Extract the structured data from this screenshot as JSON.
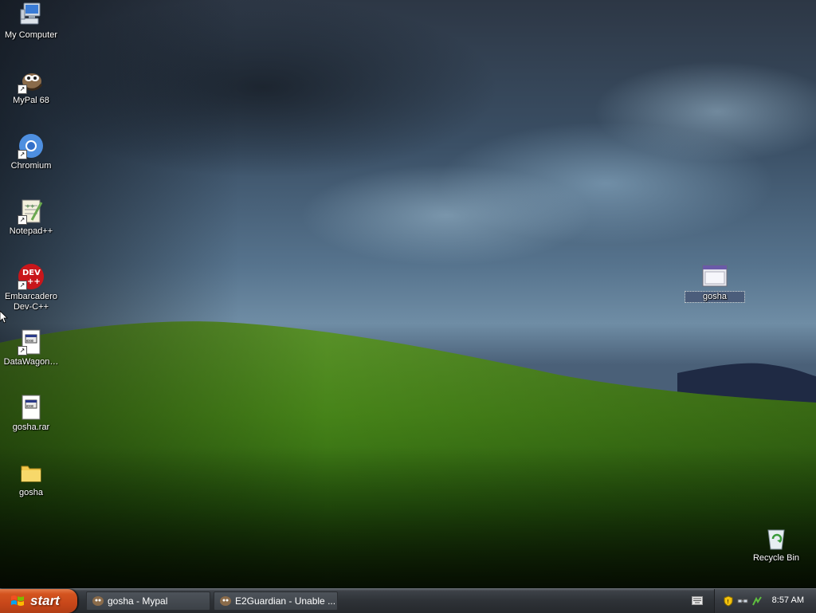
{
  "desktop": {
    "icons": [
      {
        "label": "My Computer",
        "icon": "my-computer-icon"
      },
      {
        "label": "MyPal 68",
        "icon": "mypal-icon"
      },
      {
        "label": "Chromium",
        "icon": "chromium-icon"
      },
      {
        "label": "Notepad++",
        "icon": "notepad-plus-plus-icon"
      },
      {
        "label": "Embarcadero Dev-C++",
        "icon": "devcpp-icon",
        "badge": "DEV ++"
      },
      {
        "label": "DataWagon…",
        "icon": "executable-file-icon"
      },
      {
        "label": "gosha.rar",
        "icon": "executable-file-icon"
      },
      {
        "label": "gosha",
        "icon": "folder-icon"
      },
      {
        "label": "gosha",
        "icon": "application-window-icon"
      },
      {
        "label": "Recycle Bin",
        "icon": "recycle-bin-icon"
      }
    ]
  },
  "taskbar": {
    "start_label": "start",
    "tasks": [
      {
        "label": "gosha - Mypal",
        "icon": "mypal-icon"
      },
      {
        "label": "E2Guardian - Unable ...",
        "icon": "mypal-icon"
      }
    ],
    "tray": {
      "icons": [
        "keyboard-icon",
        "security-shield-icon",
        "network-icon",
        "update-icon"
      ],
      "clock": "8:57 AM"
    }
  },
  "colors": {
    "start_button": "#d4541f",
    "taskbar": "#2e3237",
    "hill_green": "#4f8a1c",
    "sky": "#56738d"
  }
}
